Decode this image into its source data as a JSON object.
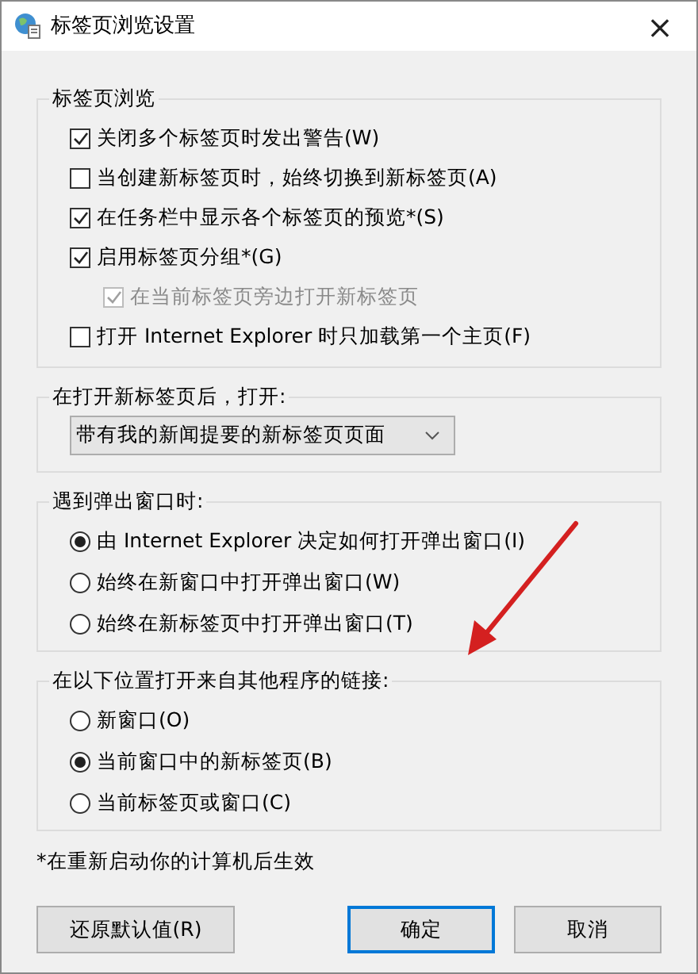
{
  "window": {
    "title": "标签页浏览设置",
    "close": "×"
  },
  "groups": [
    {
      "kind": "checks",
      "title": "标签页浏览",
      "items": [
        {
          "label": "关闭多个标签页时发出警告(W)",
          "checked": true,
          "disabled": false
        },
        {
          "label": "当创建新标签页时，始终切换到新标签页(A)",
          "checked": false,
          "disabled": false
        },
        {
          "label": "在任务栏中显示各个标签页的预览*(S)",
          "checked": true,
          "disabled": false
        },
        {
          "label": "启用标签页分组*(G)",
          "checked": true,
          "disabled": false,
          "children": [
            {
              "label": "在当前标签页旁边打开新标签页",
              "checked": true,
              "disabled": true
            }
          ]
        },
        {
          "label": "打开 Internet Explorer 时只加载第一个主页(F)",
          "checked": false,
          "disabled": false
        }
      ]
    },
    {
      "kind": "dropdown",
      "title": "在打开新标签页后，打开:",
      "value": "带有我的新闻提要的新标签页页面"
    },
    {
      "kind": "radios",
      "title": "遇到弹出窗口时:",
      "items": [
        {
          "label": "由 Internet Explorer 决定如何打开弹出窗口(I)",
          "selected": true
        },
        {
          "label": "始终在新窗口中打开弹出窗口(W)",
          "selected": false
        },
        {
          "label": "始终在新标签页中打开弹出窗口(T)",
          "selected": false
        }
      ]
    },
    {
      "kind": "radios",
      "title": "在以下位置打开来自其他程序的链接:",
      "items": [
        {
          "label": "新窗口(O)",
          "selected": false
        },
        {
          "label": "当前窗口中的新标签页(B)",
          "selected": true
        },
        {
          "label": "当前标签页或窗口(C)",
          "selected": false
        }
      ]
    }
  ],
  "note": "*在重新启动你的计算机后生效",
  "buttons": [
    {
      "label": "还原默认值(R)",
      "default": false
    },
    {
      "label": "确定",
      "default": true
    },
    {
      "label": "取消",
      "default": false
    }
  ]
}
